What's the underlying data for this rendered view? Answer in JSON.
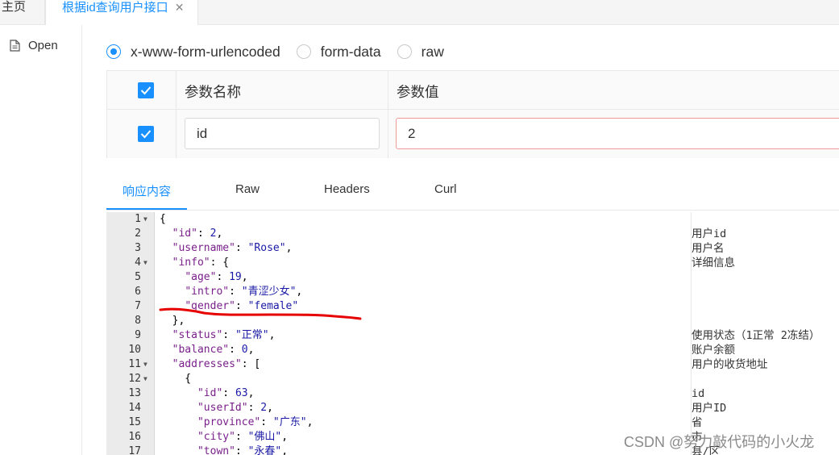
{
  "tabs": {
    "home_label": "主页",
    "api_label": "根据id查询用户接口",
    "close_glyph": "✕"
  },
  "sidebar": {
    "open_label": "Open"
  },
  "body_type": {
    "options": [
      "x-www-form-urlencoded",
      "form-data",
      "raw"
    ],
    "selected": "x-www-form-urlencoded"
  },
  "params": {
    "header_name": "参数名称",
    "header_value": "参数值",
    "rows": [
      {
        "name": "id",
        "value": "2",
        "checked": true
      }
    ]
  },
  "response_tabs": {
    "items": [
      "响应内容",
      "Raw",
      "Headers",
      "Curl"
    ],
    "active": "响应内容"
  },
  "code_lines": [
    {
      "n": "1",
      "fold": true,
      "text": "{",
      "comment": ""
    },
    {
      "n": "2",
      "fold": false,
      "text": "  \"id\": 2,",
      "comment": "用户id"
    },
    {
      "n": "3",
      "fold": false,
      "text": "  \"username\": \"Rose\",",
      "comment": "用户名"
    },
    {
      "n": "4",
      "fold": true,
      "text": "  \"info\": {",
      "comment": "详细信息"
    },
    {
      "n": "5",
      "fold": false,
      "text": "    \"age\": 19,",
      "comment": ""
    },
    {
      "n": "6",
      "fold": false,
      "text": "    \"intro\": \"青涩少女\",",
      "comment": ""
    },
    {
      "n": "7",
      "fold": false,
      "text": "    \"gender\": \"female\"",
      "comment": ""
    },
    {
      "n": "8",
      "fold": false,
      "text": "  },",
      "comment": ""
    },
    {
      "n": "9",
      "fold": false,
      "text": "  \"status\": \"正常\",",
      "comment": "使用状态（1正常 2冻结）"
    },
    {
      "n": "10",
      "fold": false,
      "text": "  \"balance\": 0,",
      "comment": "账户余额"
    },
    {
      "n": "11",
      "fold": true,
      "text": "  \"addresses\": [",
      "comment": "用户的收货地址"
    },
    {
      "n": "12",
      "fold": true,
      "text": "    {",
      "comment": ""
    },
    {
      "n": "13",
      "fold": false,
      "text": "      \"id\": 63,",
      "comment": "id"
    },
    {
      "n": "14",
      "fold": false,
      "text": "      \"userId\": 2,",
      "comment": "用户ID"
    },
    {
      "n": "15",
      "fold": false,
      "text": "      \"province\": \"广东\",",
      "comment": "省"
    },
    {
      "n": "16",
      "fold": false,
      "text": "      \"city\": \"佛山\",",
      "comment": "市"
    },
    {
      "n": "17",
      "fold": false,
      "text": "      \"town\": \"永春\",",
      "comment": "县/区"
    }
  ],
  "watermark": "CSDN @努力敲代码的小火龙",
  "colors": {
    "accent": "#1890ff",
    "annotation_red": "#e60000"
  }
}
